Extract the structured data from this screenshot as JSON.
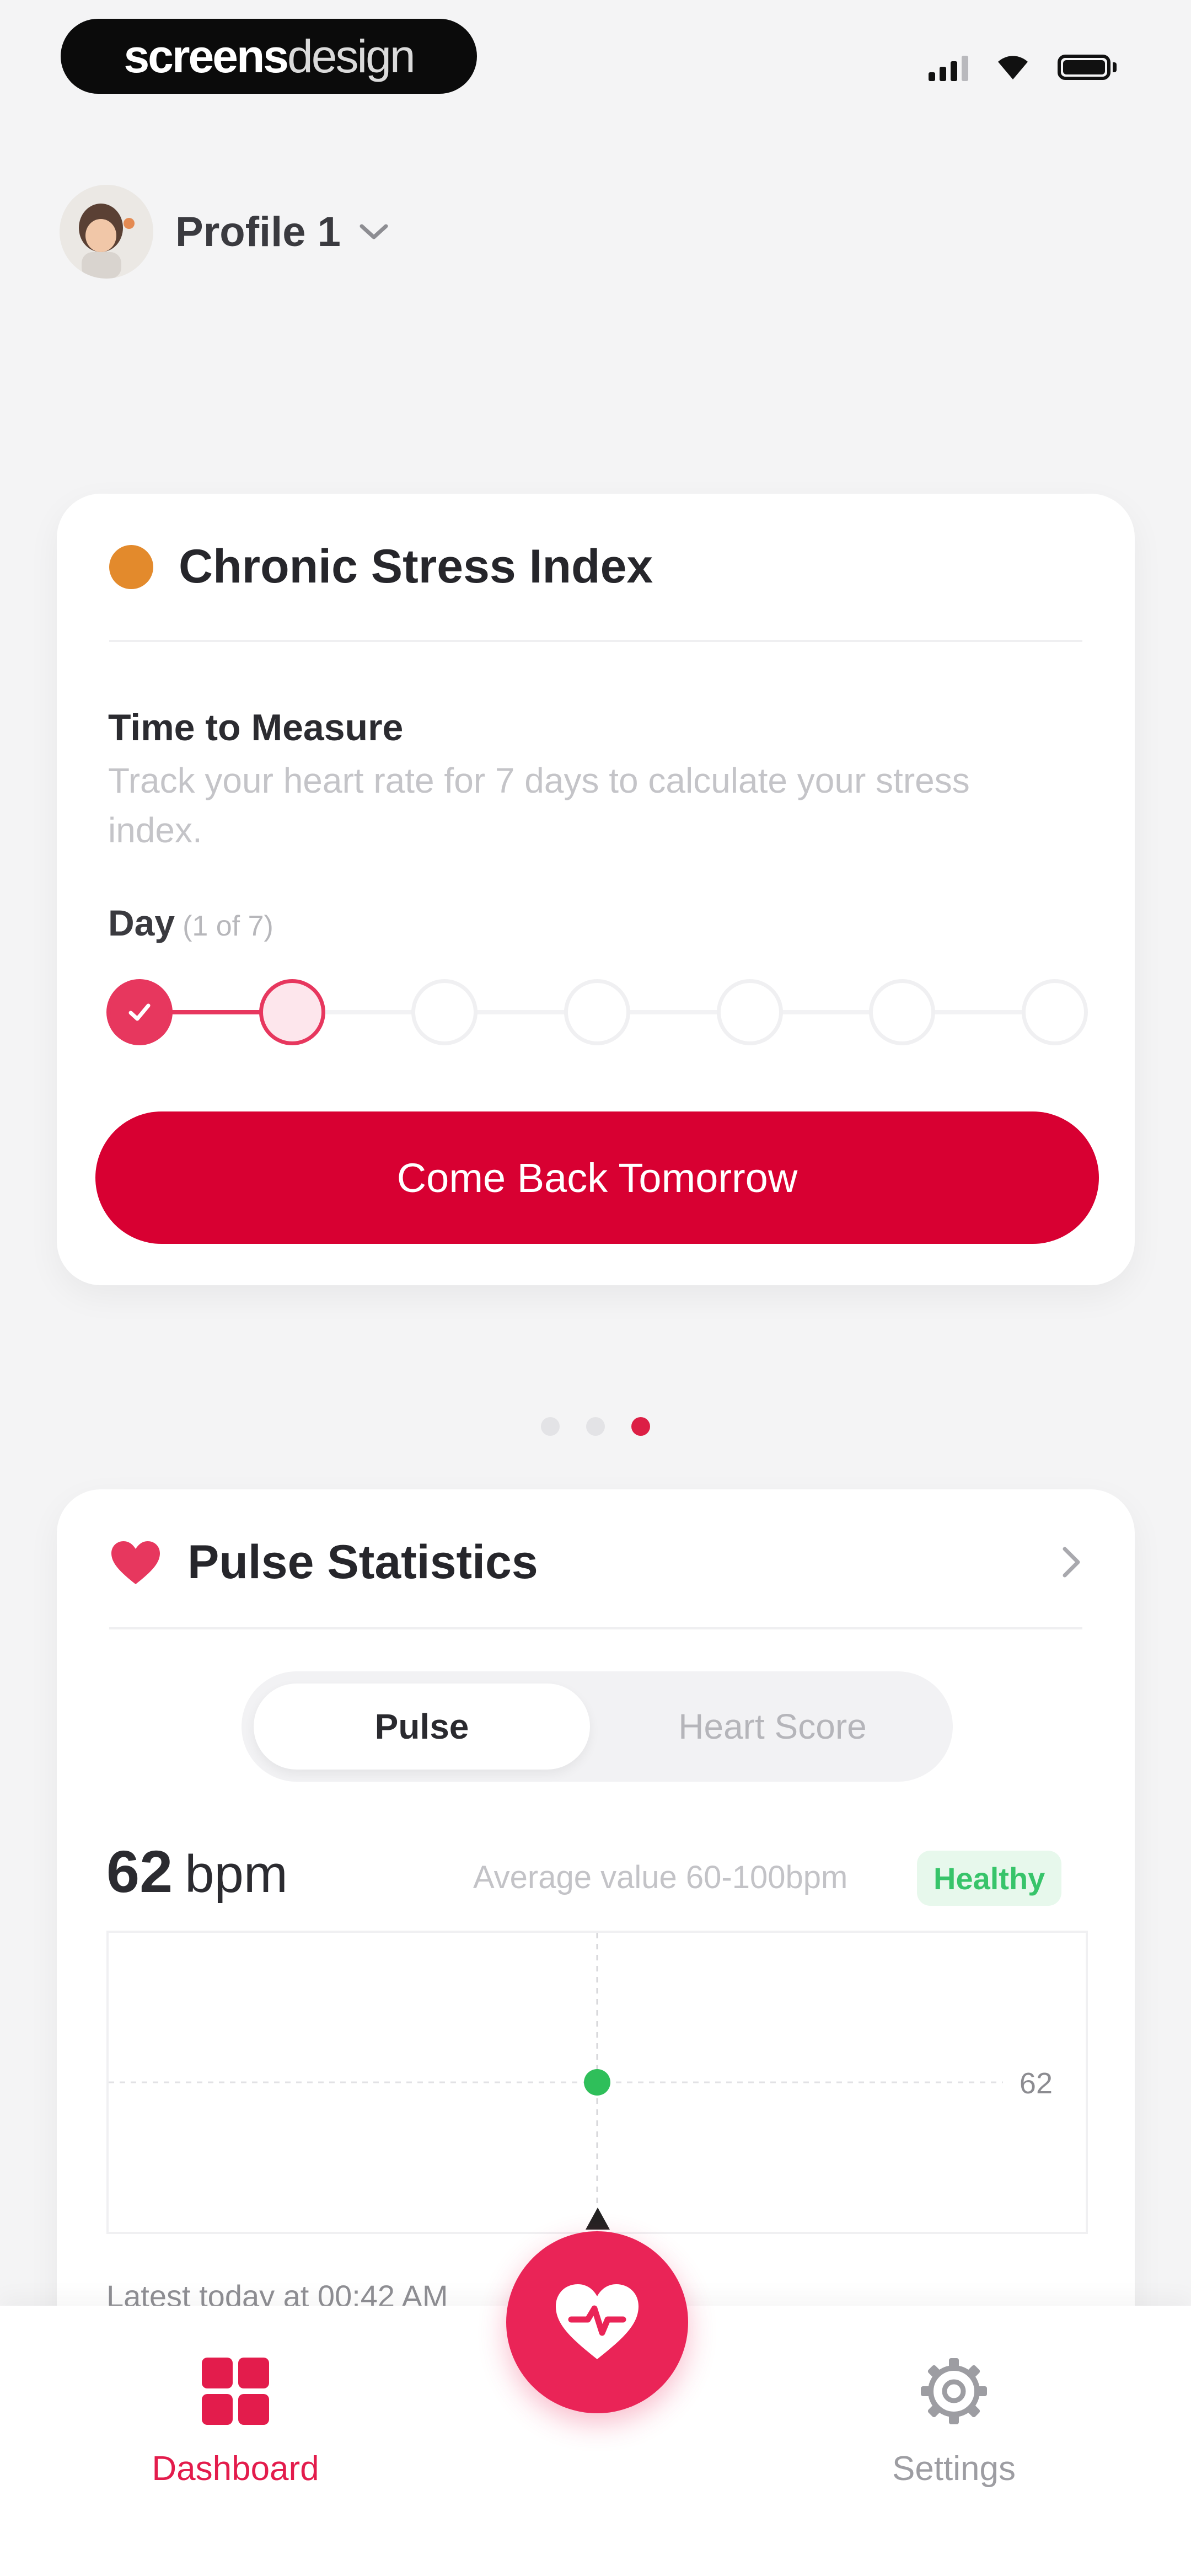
{
  "status_bar": {
    "watermark_bold": "screens",
    "watermark_light": "design"
  },
  "profile": {
    "name": "Profile 1"
  },
  "stress_card": {
    "title": "Chronic Stress Index",
    "measure_title": "Time to Measure",
    "measure_desc": "Track your heart rate for 7 days to calculate your stress index.",
    "day_label": "Day",
    "day_count": "(1 of 7)",
    "days_total": 7,
    "days_completed": 1,
    "button_label": "Come Back Tomorrow"
  },
  "pager": {
    "total": 3,
    "active_index": 2
  },
  "pulse_card": {
    "title": "Pulse Statistics",
    "tabs": [
      "Pulse",
      "Heart Score"
    ],
    "active_tab": "Pulse",
    "value": "62",
    "unit": "bpm",
    "average_text": "Average value 60-100bpm",
    "status_badge": "Healthy",
    "latest_text": "Latest today at 00:42 AM"
  },
  "chart_data": {
    "type": "scatter",
    "series": [
      {
        "values": [
          62
        ]
      }
    ],
    "line_value_label": "62"
  },
  "tab_bar": {
    "dashboard_label": "Dashboard",
    "settings_label": "Settings"
  },
  "colors": {
    "accent_red": "#d80032",
    "pink": "#e7375e",
    "orange_dot": "#e38a2c",
    "healthy_green": "#37c46a",
    "healthy_bg": "#e7f8ec"
  }
}
